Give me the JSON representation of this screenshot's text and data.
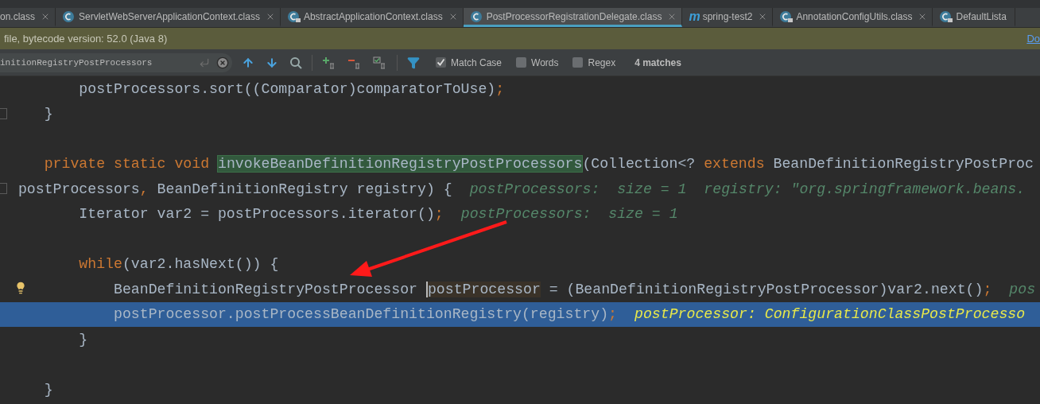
{
  "tabs": [
    {
      "label": "on.class",
      "kind": "plain",
      "closable": true,
      "selected": false
    },
    {
      "label": "ServletWebServerApplicationContext.class",
      "kind": "class",
      "closable": true,
      "selected": false
    },
    {
      "label": "AbstractApplicationContext.class",
      "kind": "locked-class",
      "closable": true,
      "selected": false
    },
    {
      "label": "PostProcessorRegistrationDelegate.class",
      "kind": "class",
      "closable": true,
      "selected": true
    },
    {
      "label": "spring-test2",
      "kind": "module",
      "badge": "m",
      "closable": true,
      "selected": false
    },
    {
      "label": "AnnotationConfigUtils.class",
      "kind": "locked-class",
      "closable": true,
      "selected": false
    },
    {
      "label": "DefaultLista",
      "kind": "locked-class",
      "closable": false,
      "selected": false
    }
  ],
  "info_bar": {
    "message": "file, bytecode version: 52.0 (Java 8)",
    "link": "Do"
  },
  "search": {
    "value": "initionRegistryPostProcessors",
    "options": [
      {
        "label": "Match Case",
        "checked": true
      },
      {
        "label": "Words",
        "checked": false
      },
      {
        "label": "Regex",
        "checked": false
      }
    ],
    "matches": "4 matches"
  },
  "lines": [
    {
      "selected": false,
      "tokens": [
        {
          "kind": "plain",
          "text": "        postProcessors.sort((Comparator)comparatorToUse)"
        },
        {
          "kind": "punct",
          "text": ";"
        }
      ]
    },
    {
      "selected": false,
      "fold": true,
      "tokens": [
        {
          "kind": "plain",
          "text": "    }"
        }
      ]
    },
    {
      "selected": false
    },
    {
      "selected": false,
      "tokens": [
        {
          "kind": "keyword",
          "text": "    private static void "
        },
        {
          "kind": "match",
          "text": "invokeBeanDefinitionRegistryPostProcessors"
        },
        {
          "kind": "plain",
          "text": "(Collection<? "
        },
        {
          "kind": "keyword",
          "text": "extends "
        },
        {
          "kind": "plain",
          "text": "BeanDefinitionRegistryPostProc"
        }
      ]
    },
    {
      "selected": false,
      "fold": true,
      "tokens": [
        {
          "kind": "plain",
          "text": " postProcessors"
        },
        {
          "kind": "punct",
          "text": ","
        },
        {
          "kind": "plain",
          "text": " BeanDefinitionRegistry registry) {"
        }
      ],
      "hint": "postProcessors:  size = 1  registry: \"org.springframework.beans."
    },
    {
      "selected": false,
      "tokens": [
        {
          "kind": "plain",
          "text": "        Iterator var2 = postProcessors.iterator()"
        },
        {
          "kind": "punct",
          "text": ";"
        }
      ],
      "hint": "postProcessors:  size = 1"
    },
    {
      "selected": false
    },
    {
      "selected": false,
      "tokens": [
        {
          "kind": "keyword",
          "text": "        while"
        },
        {
          "kind": "plain",
          "text": "(var2.hasNext()) {"
        }
      ]
    },
    {
      "selected": false,
      "bulb": true,
      "tokens": [
        {
          "kind": "plain",
          "text": "            BeanDefinitionRegistryPostProcessor "
        },
        {
          "kind": "usage",
          "text": "postProcessor"
        },
        {
          "kind": "plain",
          "text": " = (BeanDefinitionRegistryPostProcessor)var2.next()"
        },
        {
          "kind": "punct",
          "text": ";"
        }
      ],
      "hint": "pos"
    },
    {
      "selected": true,
      "tokens": [
        {
          "kind": "plain",
          "text": "            postProcessor.postProcessBeanDefinitionRegistry(registry)"
        },
        {
          "kind": "punct",
          "text": ";"
        }
      ],
      "hint": "postProcessor: ConfigurationClassPostProcesso"
    },
    {
      "selected": false,
      "tokens": [
        {
          "kind": "plain",
          "text": "        }"
        }
      ]
    },
    {
      "selected": false
    },
    {
      "selected": false,
      "tokens": [
        {
          "kind": "plain",
          "text": "    }"
        }
      ]
    }
  ]
}
